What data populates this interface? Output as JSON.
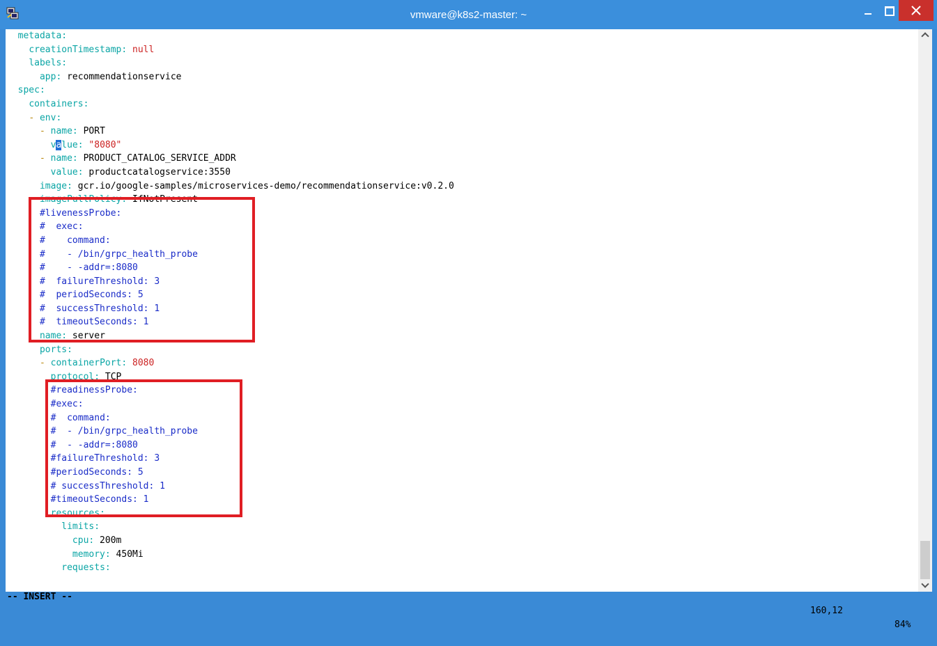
{
  "window": {
    "title": "vmware@k8s2-master: ~"
  },
  "editor": {
    "lines": [
      {
        "segments": [
          {
            "t": "  "
          },
          {
            "t": "metadata:",
            "c": "k"
          }
        ]
      },
      {
        "segments": [
          {
            "t": "    "
          },
          {
            "t": "creationTimestamp:",
            "c": "k"
          },
          {
            "t": " "
          },
          {
            "t": "null",
            "c": "s"
          }
        ]
      },
      {
        "segments": [
          {
            "t": "    "
          },
          {
            "t": "labels:",
            "c": "k"
          }
        ]
      },
      {
        "segments": [
          {
            "t": "      "
          },
          {
            "t": "app:",
            "c": "k"
          },
          {
            "t": " recommendationservice"
          }
        ]
      },
      {
        "segments": [
          {
            "t": "  "
          },
          {
            "t": "spec:",
            "c": "k"
          }
        ]
      },
      {
        "segments": [
          {
            "t": "    "
          },
          {
            "t": "containers:",
            "c": "k"
          }
        ]
      },
      {
        "segments": [
          {
            "t": "    "
          },
          {
            "t": "- ",
            "c": "d"
          },
          {
            "t": "env:",
            "c": "k"
          }
        ]
      },
      {
        "segments": [
          {
            "t": "      "
          },
          {
            "t": "- ",
            "c": "d"
          },
          {
            "t": "name:",
            "c": "k"
          },
          {
            "t": " PORT"
          }
        ]
      },
      {
        "segments": [
          {
            "t": "        "
          },
          {
            "t": "v",
            "c": "k"
          },
          {
            "t": "a",
            "c": "cur"
          },
          {
            "t": "lue:",
            "c": "k"
          },
          {
            "t": " "
          },
          {
            "t": "\"8080\"",
            "c": "s"
          }
        ]
      },
      {
        "segments": [
          {
            "t": "      "
          },
          {
            "t": "- ",
            "c": "d"
          },
          {
            "t": "name:",
            "c": "k"
          },
          {
            "t": " PRODUCT_CATALOG_SERVICE_ADDR"
          }
        ]
      },
      {
        "segments": [
          {
            "t": "        "
          },
          {
            "t": "value:",
            "c": "k"
          },
          {
            "t": " productcatalogservice:3550"
          }
        ]
      },
      {
        "segments": [
          {
            "t": "      "
          },
          {
            "t": "image:",
            "c": "k"
          },
          {
            "t": " gcr.io/google-samples/microservices-demo/recommendationservice:v0.2.0"
          }
        ]
      },
      {
        "segments": [
          {
            "t": "      "
          },
          {
            "t": "imagePullPolicy:",
            "c": "k"
          },
          {
            "t": " IfNotPresent"
          }
        ]
      },
      {
        "segments": [
          {
            "t": "      "
          },
          {
            "t": "#livenessProbe:",
            "c": "c"
          }
        ]
      },
      {
        "segments": [
          {
            "t": "      "
          },
          {
            "t": "#  exec:",
            "c": "c"
          }
        ]
      },
      {
        "segments": [
          {
            "t": "      "
          },
          {
            "t": "#    command:",
            "c": "c"
          }
        ]
      },
      {
        "segments": [
          {
            "t": "      "
          },
          {
            "t": "#    - /bin/grpc_health_probe",
            "c": "c"
          }
        ]
      },
      {
        "segments": [
          {
            "t": "      "
          },
          {
            "t": "#    - -addr=:8080",
            "c": "c"
          }
        ]
      },
      {
        "segments": [
          {
            "t": "      "
          },
          {
            "t": "#  failureThreshold: 3",
            "c": "c"
          }
        ]
      },
      {
        "segments": [
          {
            "t": "      "
          },
          {
            "t": "#  periodSeconds: 5",
            "c": "c"
          }
        ]
      },
      {
        "segments": [
          {
            "t": "      "
          },
          {
            "t": "#  successThreshold: 1",
            "c": "c"
          }
        ]
      },
      {
        "segments": [
          {
            "t": "      "
          },
          {
            "t": "#  timeoutSeconds: 1",
            "c": "c"
          }
        ]
      },
      {
        "segments": [
          {
            "t": "      "
          },
          {
            "t": "name:",
            "c": "k"
          },
          {
            "t": " server"
          }
        ]
      },
      {
        "segments": [
          {
            "t": "      "
          },
          {
            "t": "ports:",
            "c": "k"
          }
        ]
      },
      {
        "segments": [
          {
            "t": "      "
          },
          {
            "t": "- ",
            "c": "d"
          },
          {
            "t": "containerPort:",
            "c": "k"
          },
          {
            "t": " "
          },
          {
            "t": "8080",
            "c": "s"
          }
        ]
      },
      {
        "segments": [
          {
            "t": "        "
          },
          {
            "t": "protocol:",
            "c": "k"
          },
          {
            "t": " TCP"
          }
        ]
      },
      {
        "segments": [
          {
            "t": "        "
          },
          {
            "t": "#readinessProbe:",
            "c": "c"
          }
        ]
      },
      {
        "segments": [
          {
            "t": "        "
          },
          {
            "t": "#exec:",
            "c": "c"
          }
        ]
      },
      {
        "segments": [
          {
            "t": "        "
          },
          {
            "t": "#  command:",
            "c": "c"
          }
        ]
      },
      {
        "segments": [
          {
            "t": "        "
          },
          {
            "t": "#  - /bin/grpc_health_probe",
            "c": "c"
          }
        ]
      },
      {
        "segments": [
          {
            "t": "        "
          },
          {
            "t": "#  - -addr=:8080",
            "c": "c"
          }
        ]
      },
      {
        "segments": [
          {
            "t": "        "
          },
          {
            "t": "#failureThreshold: 3",
            "c": "c"
          }
        ]
      },
      {
        "segments": [
          {
            "t": "        "
          },
          {
            "t": "#periodSeconds: 5",
            "c": "c"
          }
        ]
      },
      {
        "segments": [
          {
            "t": "        "
          },
          {
            "t": "# successThreshold: 1",
            "c": "c"
          }
        ]
      },
      {
        "segments": [
          {
            "t": "        "
          },
          {
            "t": "#timeoutSeconds: 1",
            "c": "c"
          }
        ]
      },
      {
        "segments": [
          {
            "t": "        "
          },
          {
            "t": "resources:",
            "c": "k"
          }
        ]
      },
      {
        "segments": [
          {
            "t": "          "
          },
          {
            "t": "limits:",
            "c": "k"
          }
        ]
      },
      {
        "segments": [
          {
            "t": "            "
          },
          {
            "t": "cpu:",
            "c": "k"
          },
          {
            "t": " 200m"
          }
        ]
      },
      {
        "segments": [
          {
            "t": "            "
          },
          {
            "t": "memory:",
            "c": "k"
          },
          {
            "t": " 450Mi"
          }
        ]
      },
      {
        "segments": [
          {
            "t": "          "
          },
          {
            "t": "requests:",
            "c": "k"
          }
        ]
      }
    ]
  },
  "status": {
    "mode": "-- INSERT --",
    "position": "160,12",
    "percent": "84%"
  },
  "colors": {
    "key": "#0aa5a5",
    "string": "#cc2222",
    "dash": "#b8860b",
    "comment": "#1a2cc8",
    "highlight": "#e01e24",
    "titlebar": "#3b8fdc"
  },
  "icons": {
    "app": "putty-icon",
    "minimize": "minimize-icon",
    "maximize": "maximize-icon",
    "close": "close-icon"
  }
}
